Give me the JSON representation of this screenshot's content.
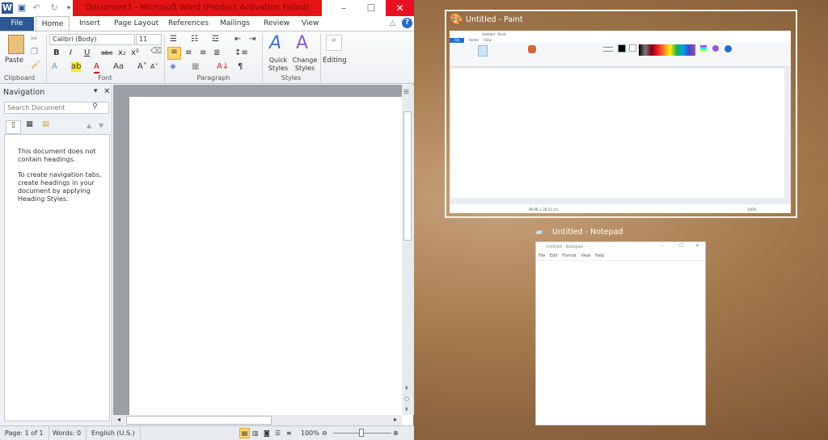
{
  "word": {
    "title": "Document1  -  Microsoft Word (Product Activation Failed)",
    "tabs": [
      "File",
      "Home",
      "Insert",
      "Page Layout",
      "References",
      "Mailings",
      "Review",
      "View"
    ],
    "font_name": "Calibri (Body)",
    "font_size": "11",
    "groups": {
      "clipboard": "Clipboard",
      "font": "Font",
      "paragraph": "Paragraph",
      "styles": "Styles"
    },
    "paste": "Paste",
    "quick_styles": "Quick Styles",
    "change_styles": "Change Styles",
    "editing": "Editing",
    "nav": {
      "title": "Navigation",
      "search_placeholder": "Search Document",
      "msg1": "This document does not contain headings.",
      "msg2": "To create navigation tabs, create headings in your document by applying Heading Styles."
    },
    "status": {
      "page": "Page: 1 of 1",
      "words": "Words: 0",
      "lang": "English (U.S.)",
      "zoom": "100%"
    },
    "title_color": "#e31414"
  },
  "paint": {
    "label": "Untitled - Paint",
    "title": "Untitled - Paint",
    "tabs": [
      "File",
      "Home",
      "View"
    ],
    "status_size": "98.96 × 28.52 cm",
    "zoom": "100%"
  },
  "notepad": {
    "label": "Untitled - Notepad",
    "title": "Untitled - Notepad",
    "menu": [
      "File",
      "Edit",
      "Format",
      "View",
      "Help"
    ]
  }
}
